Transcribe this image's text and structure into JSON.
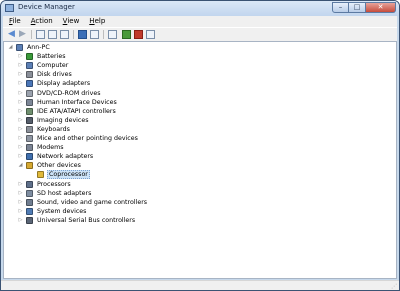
{
  "window": {
    "title": "Device Manager",
    "close_glyph": "✕",
    "min_glyph": "–",
    "max_glyph": "□"
  },
  "menu": [
    {
      "label": "File",
      "key": "F",
      "rest": "ile"
    },
    {
      "label": "Action",
      "key": "A",
      "rest": "ction"
    },
    {
      "label": "View",
      "key": "V",
      "rest": "iew"
    },
    {
      "label": "Help",
      "key": "H",
      "rest": "elp"
    }
  ],
  "toolbar": {
    "back_icon": "back-arrow-icon",
    "forward_icon": "forward-arrow-icon"
  },
  "tree": {
    "root": {
      "label": "Ann-PC",
      "expander": "◢",
      "icon": "computer-icon",
      "color": "#5b7fb5"
    },
    "categories": [
      {
        "label": "Batteries",
        "icon": "battery-icon",
        "color": "#3a9a3a"
      },
      {
        "label": "Computer",
        "icon": "computer-icon",
        "color": "#5b7fb5"
      },
      {
        "label": "Disk drives",
        "icon": "disk-drive-icon",
        "color": "#8a8f99"
      },
      {
        "label": "Display adapters",
        "icon": "display-adapter-icon",
        "color": "#4a76b8"
      },
      {
        "label": "DVD/CD-ROM drives",
        "icon": "dvd-drive-icon",
        "color": "#9aa1ad"
      },
      {
        "label": "Human Interface Devices",
        "icon": "hid-icon",
        "color": "#7c8696"
      },
      {
        "label": "IDE ATA/ATAPI controllers",
        "icon": "ide-controller-icon",
        "color": "#6f8f6f"
      },
      {
        "label": "Imaging devices",
        "icon": "camera-icon",
        "color": "#555d6a"
      },
      {
        "label": "Keyboards",
        "icon": "keyboard-icon",
        "color": "#8b9099"
      },
      {
        "label": "Mice and other pointing devices",
        "icon": "mouse-icon",
        "color": "#9097a3"
      },
      {
        "label": "Modems",
        "icon": "modem-icon",
        "color": "#7b8494"
      },
      {
        "label": "Network adapters",
        "icon": "network-adapter-icon",
        "color": "#3f6fae"
      },
      {
        "label": "Other devices",
        "icon": "unknown-device-icon",
        "color": "#d6a830",
        "expanded": true,
        "children": [
          {
            "label": "Coprocessor",
            "icon": "warning-device-icon",
            "color": "#e0b93a",
            "selected": true
          }
        ]
      },
      {
        "label": "Processors",
        "icon": "processor-icon",
        "color": "#5e6f8a"
      },
      {
        "label": "SD host adapters",
        "icon": "sd-adapter-icon",
        "color": "#7d8ca0"
      },
      {
        "label": "Sound, video and game controllers",
        "icon": "speaker-icon",
        "color": "#6f7d90"
      },
      {
        "label": "System devices",
        "icon": "system-device-icon",
        "color": "#4f7bb4"
      },
      {
        "label": "Universal Serial Bus controllers",
        "icon": "usb-icon",
        "color": "#5a6576"
      }
    ],
    "collapsed_glyph": "▷",
    "expanded_glyph": "◢"
  }
}
